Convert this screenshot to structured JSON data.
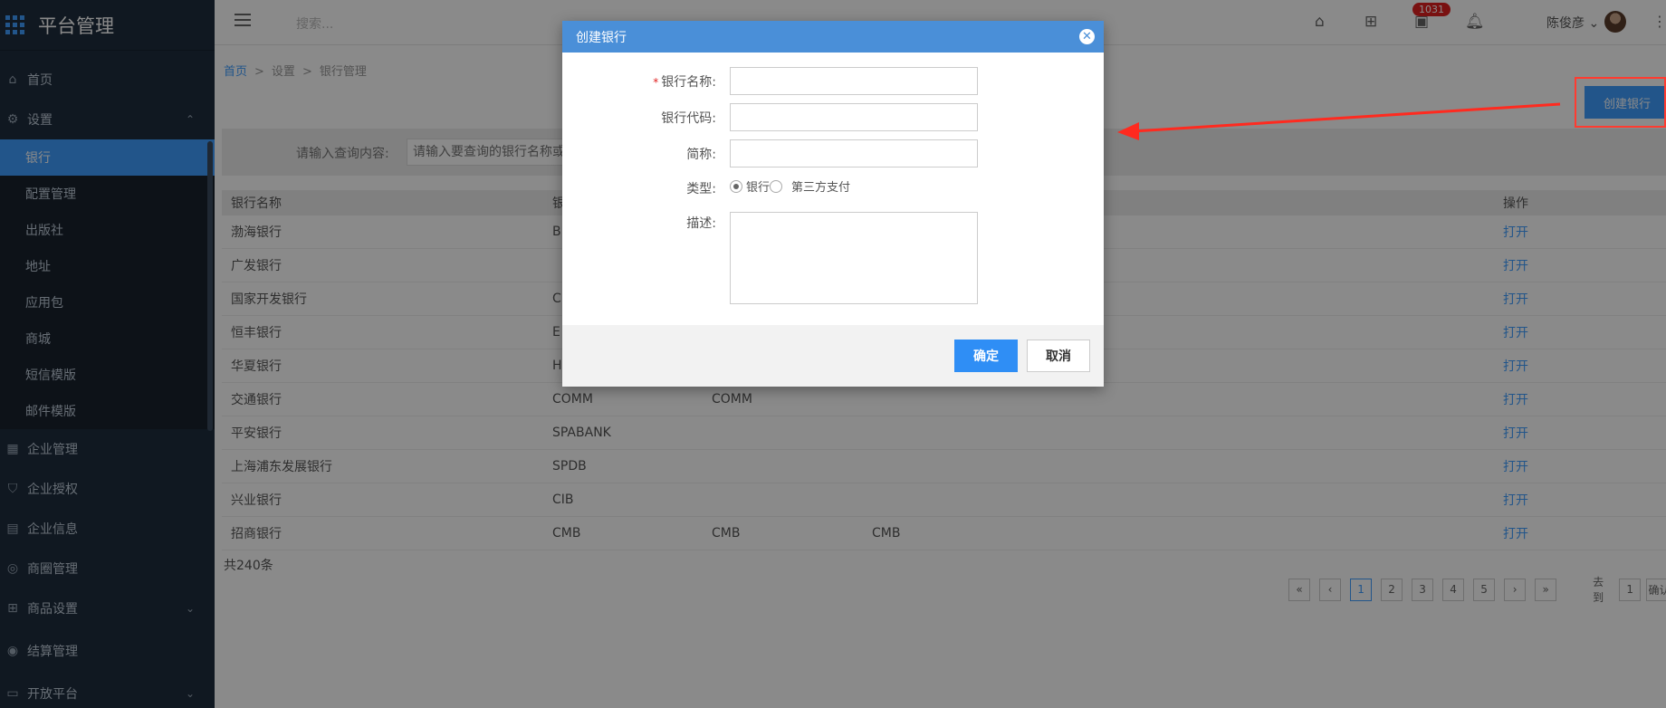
{
  "app": {
    "title": "平台管理"
  },
  "sidebar": {
    "items": [
      {
        "label": "首页",
        "icon": "home-icon"
      },
      {
        "label": "设置",
        "icon": "gear-icon",
        "expanded": true,
        "children": [
          "银行",
          "配置管理",
          "出版社",
          "地址",
          "应用包",
          "商城",
          "短信模版",
          "邮件模版"
        ],
        "active_child": "银行"
      },
      {
        "label": "企业管理",
        "icon": "building-icon"
      },
      {
        "label": "企业授权",
        "icon": "shield-icon"
      },
      {
        "label": "企业信息",
        "icon": "card-icon"
      },
      {
        "label": "商圈管理",
        "icon": "compass-icon"
      },
      {
        "label": "商品设置",
        "icon": "grid-icon"
      },
      {
        "label": "结算管理",
        "icon": "coin-icon"
      },
      {
        "label": "开放平台",
        "icon": "window-icon"
      }
    ]
  },
  "header": {
    "search_placeholder": "搜索...",
    "notification_count": "1031",
    "user_name": "陈俊彦"
  },
  "breadcrumb": {
    "home": "首页",
    "settings": "设置",
    "current": "银行管理"
  },
  "toolbar": {
    "create_label": "创建银行"
  },
  "filter": {
    "label": "请输入查询内容:",
    "placeholder": "请输入要查询的银行名称或"
  },
  "table": {
    "headers": {
      "name": "银行名称",
      "code": "银",
      "op": "操作"
    },
    "rows": [
      {
        "name": "渤海银行",
        "code": "B",
        "short": "",
        "c4": "",
        "op": "打开"
      },
      {
        "name": "广发银行",
        "code": "",
        "short": "",
        "c4": "",
        "op": "打开"
      },
      {
        "name": "国家开发银行",
        "code": "C",
        "short": "",
        "c4": "",
        "op": "打开"
      },
      {
        "name": "恒丰银行",
        "code": "E",
        "short": "",
        "c4": "",
        "op": "打开"
      },
      {
        "name": "华夏银行",
        "code": "H",
        "short": "",
        "c4": "",
        "op": "打开"
      },
      {
        "name": "交通银行",
        "code": "COMM",
        "short": "COMM",
        "c4": "",
        "op": "打开"
      },
      {
        "name": "平安银行",
        "code": "SPABANK",
        "short": "",
        "c4": "",
        "op": "打开"
      },
      {
        "name": "上海浦东发展银行",
        "code": "SPDB",
        "short": "",
        "c4": "",
        "op": "打开"
      },
      {
        "name": "兴业银行",
        "code": "CIB",
        "short": "",
        "c4": "",
        "op": "打开"
      },
      {
        "name": "招商银行",
        "code": "CMB",
        "short": "CMB",
        "c4": "CMB",
        "op": "打开"
      }
    ],
    "total": "共240条"
  },
  "pagination": {
    "first": "«",
    "prev": "‹",
    "next": "›",
    "last": "»",
    "pages": [
      "1",
      "2",
      "3",
      "4",
      "5"
    ],
    "current": "1",
    "goto_label": "去到",
    "goto_value": "1",
    "confirm": "确认"
  },
  "dialog": {
    "title": "创建银行",
    "close": "✕",
    "fields": {
      "name_label": "银行名称:",
      "code_label": "银行代码:",
      "short_label": "简称:",
      "type_label": "类型:",
      "desc_label": "描述:",
      "required_mark": "*"
    },
    "type_options": [
      "银行",
      "第三方支付"
    ],
    "type_selected": "银行",
    "ok": "确定",
    "cancel": "取消"
  },
  "colors": {
    "primary": "#409eff",
    "sidebar_bg": "#1f2d3d",
    "dialog_header": "#4a8fd8",
    "annotation": "#ff3b30"
  }
}
